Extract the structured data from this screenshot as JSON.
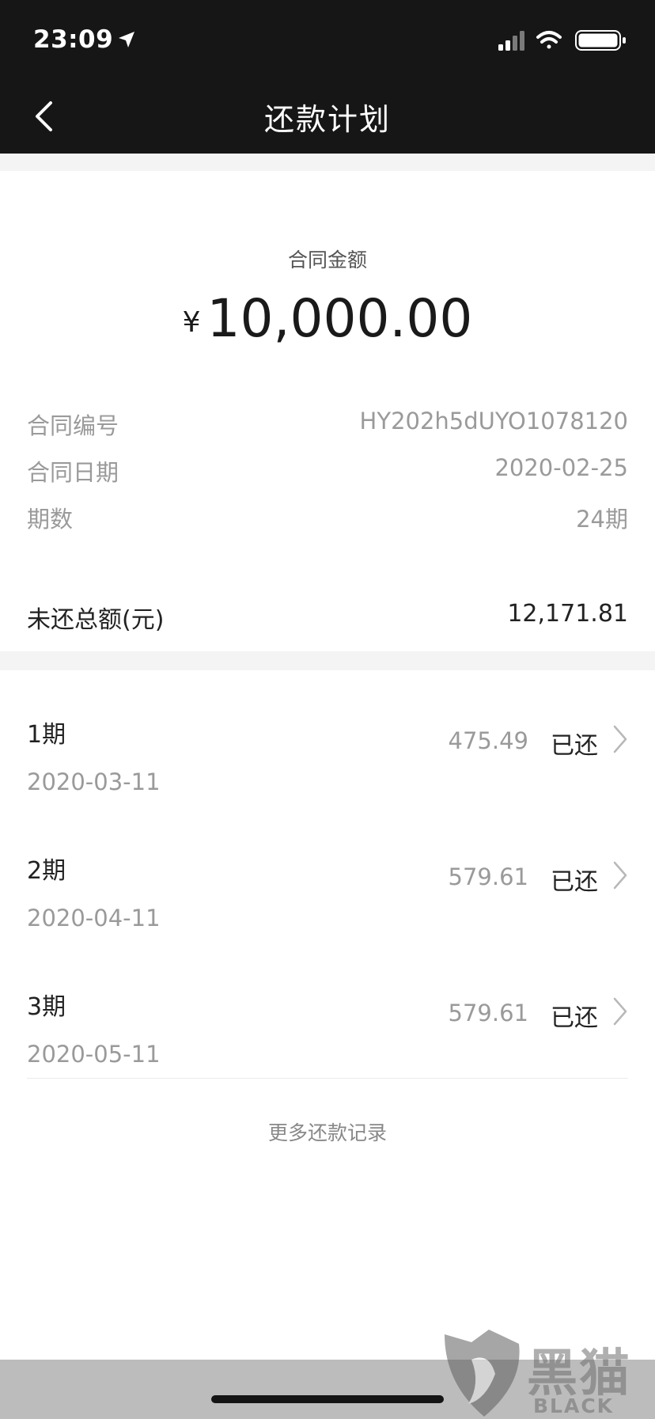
{
  "status_bar": {
    "time": "23:09"
  },
  "nav": {
    "title": "还款计划"
  },
  "contract": {
    "amount_label": "合同金额",
    "currency_symbol": "¥",
    "amount": "10,000.00"
  },
  "info": [
    {
      "label": "合同编号",
      "value": "HY202h5dUYO1078120"
    },
    {
      "label": "合同日期",
      "value": "2020-02-25"
    },
    {
      "label": "期数",
      "value": "24期"
    }
  ],
  "outstanding": {
    "label": "未还总额(元)",
    "value": "12,171.81"
  },
  "installments": [
    {
      "period": "1期",
      "date": "2020-03-11",
      "amount": "475.49",
      "status": "已还"
    },
    {
      "period": "2期",
      "date": "2020-04-11",
      "amount": "579.61",
      "status": "已还"
    },
    {
      "period": "3期",
      "date": "2020-05-11",
      "amount": "579.61",
      "status": "已还"
    }
  ],
  "more_link": "更多还款记录",
  "watermark": {
    "name_zh": "黑猫",
    "name_en": "BLACK CAT"
  },
  "colors": {
    "header_bg": "#161616",
    "band_bg": "#f4f4f4",
    "muted_text": "#9a9a9a",
    "primary_text": "#222222"
  }
}
